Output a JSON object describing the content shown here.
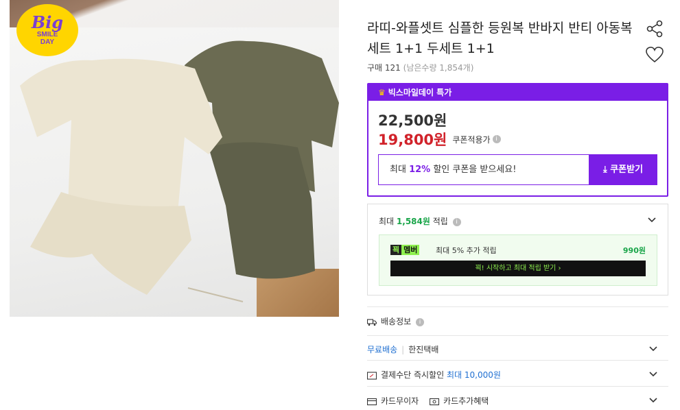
{
  "badge": {
    "big": "Big",
    "smile_day": "SMILE\nDAY"
  },
  "product": {
    "title": "라띠-와플셋트 심플한 등원복 반바지 반티 아동복 세트 1+1 두세트 1+1",
    "purchase_count": "구매 121",
    "remaining": "(남은수량 1,854개)"
  },
  "deal": {
    "header": "빅스마일데이 특가",
    "original_price": "22,500원",
    "sale_price": "19,800원",
    "coupon_applied_label": "쿠폰적용가",
    "coupon_msg_prefix": "최대 ",
    "coupon_msg_percent": "12%",
    "coupon_msg_suffix": " 할인 쿠폰을 받으세요!",
    "coupon_button": "쿠폰받기"
  },
  "points": {
    "prefix": "최대 ",
    "amount": "1,584원",
    "suffix": " 적립",
    "member_tag_dark": "꾁",
    "member_tag_light": "멤버",
    "member_text": "최대 5% 추가 적립",
    "member_amount": "990원",
    "member_button": "꾁! 시작하고 최대 적립 받기 ›"
  },
  "shipping": {
    "header": "배송정보",
    "free": "무료배송",
    "carrier": "한진택배"
  },
  "payment": {
    "label": "결제수단 즉시할인",
    "amount": "최대 10,000원"
  },
  "card": {
    "interest_free": "카드무이자",
    "extra_benefit": "카드추가혜택"
  },
  "colors": {
    "accent_purple": "#7a1ee6",
    "sale_red": "#d1222a",
    "points_green": "#1aa54a"
  },
  "icons": [
    "share-icon",
    "heart-icon",
    "crown-icon",
    "download-icon",
    "truck-icon",
    "card-icon",
    "chevron-down-icon"
  ]
}
